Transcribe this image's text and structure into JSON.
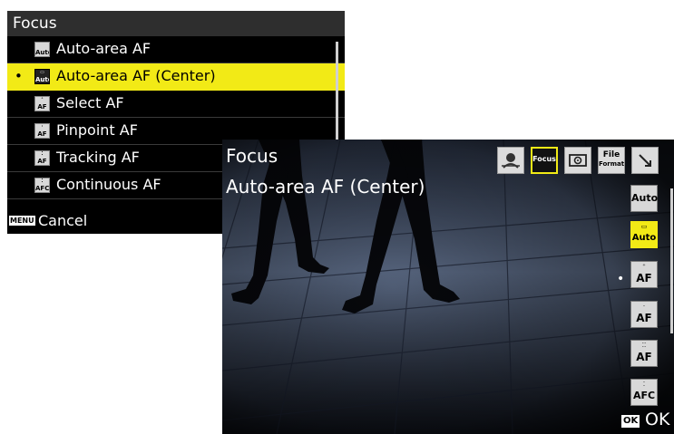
{
  "menu": {
    "title": "Focus",
    "items": [
      {
        "label": "Auto-area AF",
        "icon_top": "",
        "icon_bottom": "Auto",
        "selected": false
      },
      {
        "label": "Auto-area AF (Center)",
        "icon_top": "",
        "icon_bottom": "Auto",
        "selected": true
      },
      {
        "label": "Select AF",
        "icon_top": "",
        "icon_bottom": "AF",
        "selected": false
      },
      {
        "label": "Pinpoint AF",
        "icon_top": "",
        "icon_bottom": "AF",
        "selected": false
      },
      {
        "label": "Tracking AF",
        "icon_top": "",
        "icon_bottom": "AF",
        "selected": false
      },
      {
        "label": "Continuous AF",
        "icon_top": "",
        "icon_bottom": "AFC",
        "selected": false
      }
    ],
    "selected_bullet": "•",
    "footer_button": "MENU",
    "footer_label": "Cancel"
  },
  "liveview": {
    "title": "Focus",
    "value": "Auto-area AF (Center)",
    "tabs": [
      {
        "name": "scene-tab",
        "text": "",
        "icon": "portrait-icon"
      },
      {
        "name": "focus-tab",
        "text": "Focus",
        "active": true
      },
      {
        "name": "metering-tab",
        "text": "",
        "icon": "metering-icon"
      },
      {
        "name": "file-format-tab",
        "text_top": "File",
        "text_bottom": "Format"
      },
      {
        "name": "more-tab",
        "text": "",
        "icon": "arrow-icon"
      }
    ],
    "side_items": [
      {
        "text": "Auto",
        "active": false
      },
      {
        "text": "Auto",
        "active": true
      },
      {
        "text": "AF",
        "active": false
      },
      {
        "text": "AF",
        "active": false
      },
      {
        "text": "AF",
        "active": false
      },
      {
        "text": "AFC",
        "active": false
      }
    ],
    "ok_button": "OK",
    "ok_label": "OK",
    "selected_bullet": "•"
  },
  "colors": {
    "highlight": "#f2ea16",
    "menu_bg": "#000000",
    "header_bg": "#2e2e2e"
  }
}
